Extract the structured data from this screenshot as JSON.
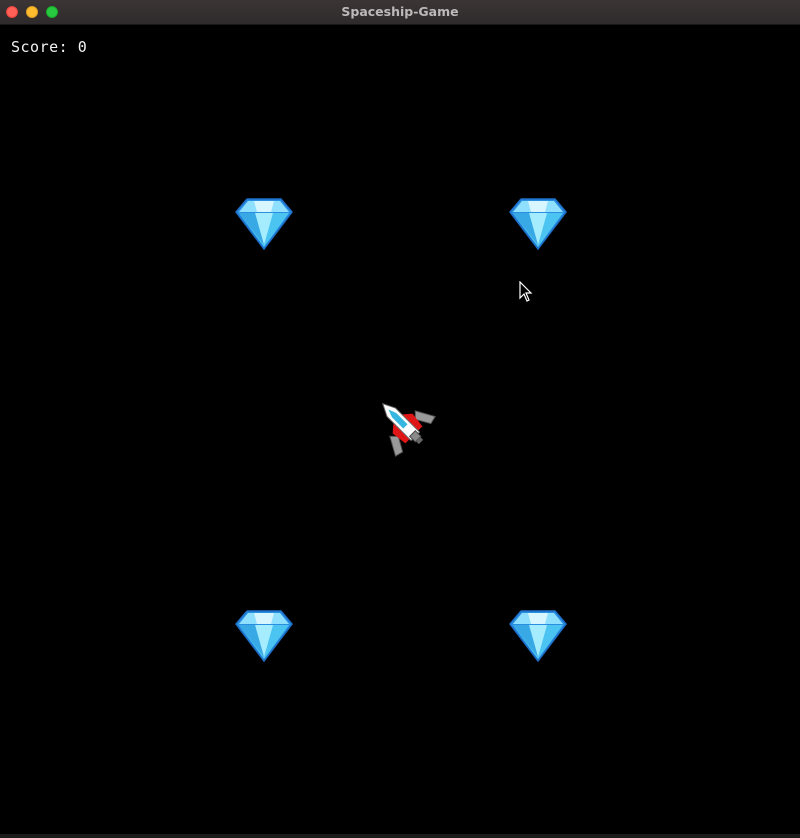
{
  "window": {
    "title": "Spaceship-Game",
    "controls": {
      "close_color": "#fe5f57",
      "minimize_color": "#febc2e",
      "maximize_color": "#28c840"
    }
  },
  "hud": {
    "score_text": "Score: 0"
  },
  "colors": {
    "background": "#000000",
    "gem_light": "#b8ecff",
    "gem_mid": "#49c3f2",
    "gem_dark": "#1f7fd0",
    "ship_red": "#e01616",
    "ship_white": "#ffffff",
    "ship_cyan": "#36b7e0",
    "ship_grey": "#9a9a9a"
  },
  "sprites": {
    "gems": [
      {
        "name": "diamond-gem-icon"
      },
      {
        "name": "diamond-gem-icon"
      },
      {
        "name": "diamond-gem-icon"
      },
      {
        "name": "diamond-gem-icon"
      }
    ],
    "player": {
      "name": "spaceship-icon"
    },
    "pointer": {
      "name": "mouse-cursor-icon"
    }
  }
}
